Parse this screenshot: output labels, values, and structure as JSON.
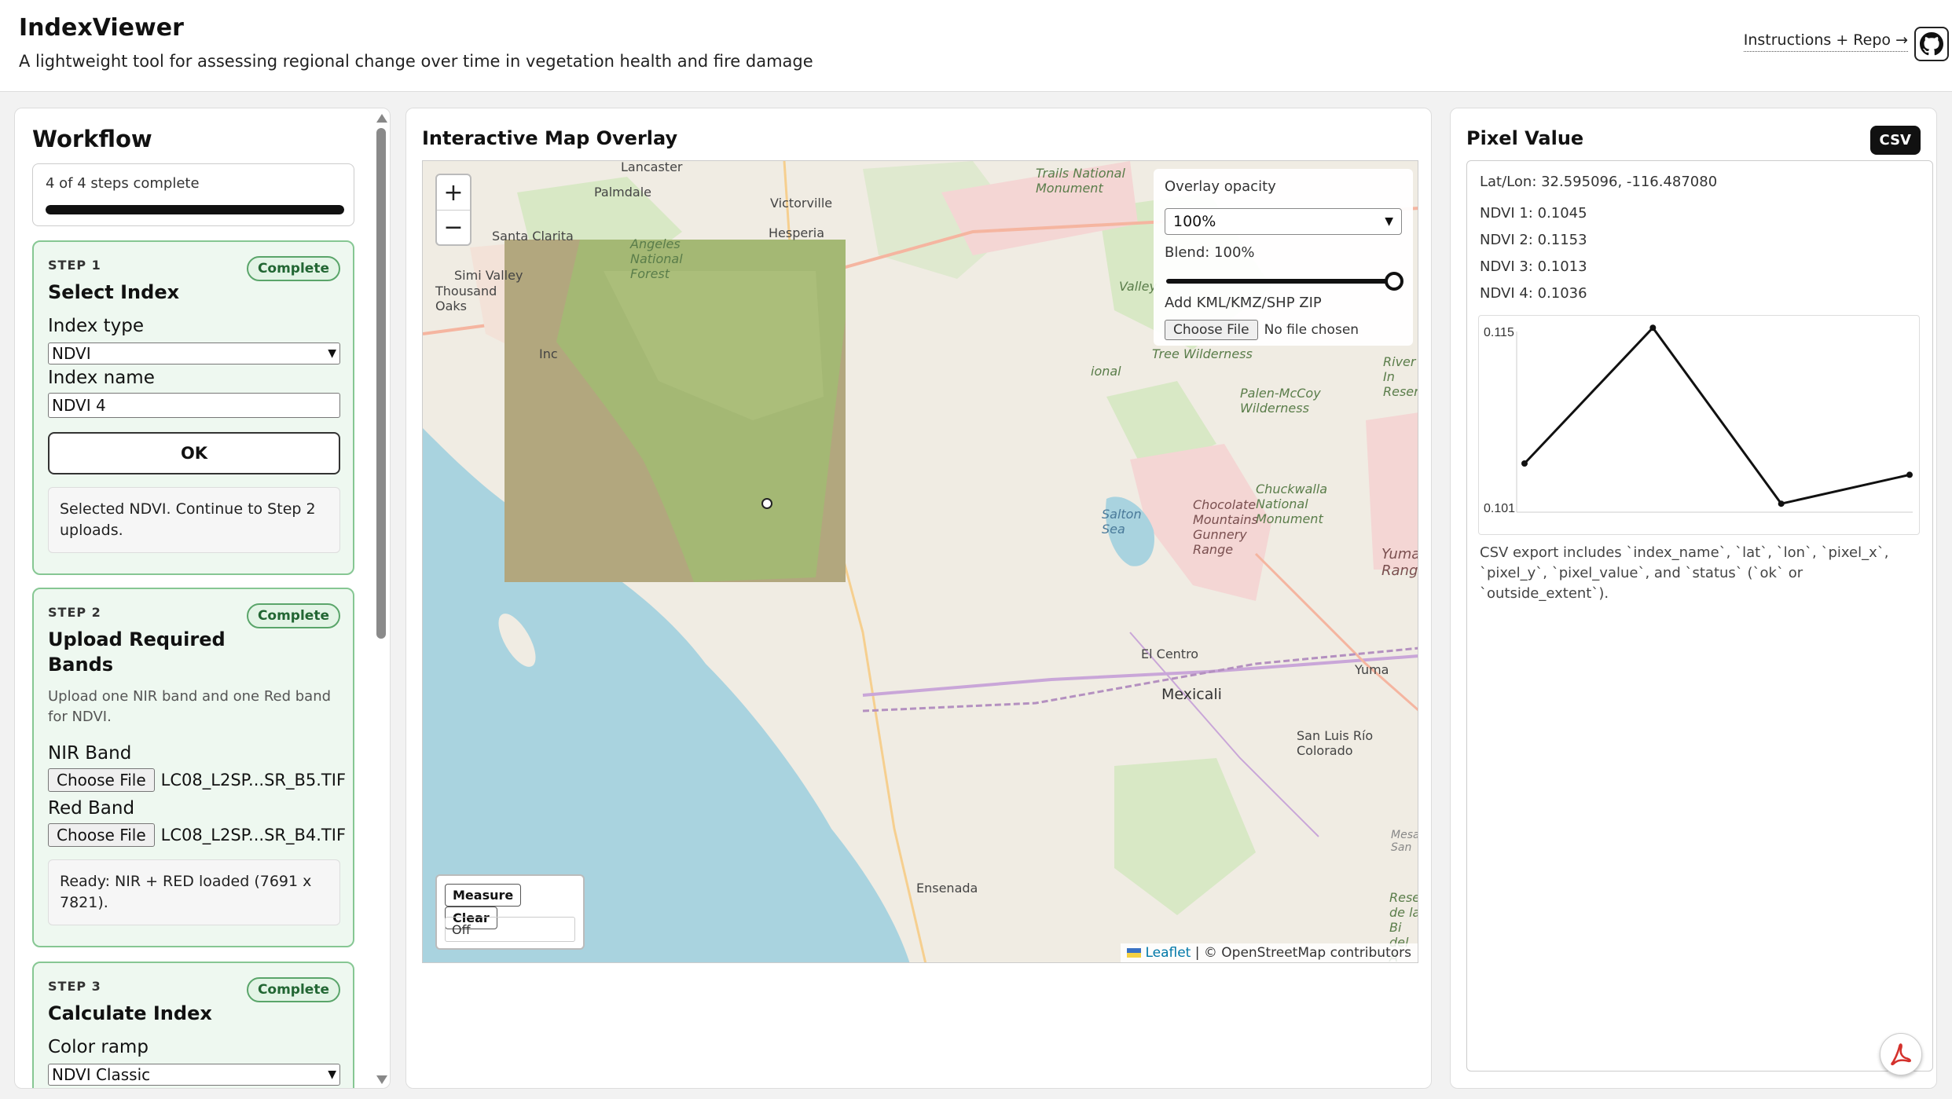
{
  "header": {
    "title": "IndexViewer",
    "subtitle": "A lightweight tool for assessing regional change over time in vegetation health and fire damage",
    "repo_link": "Instructions + Repo →",
    "github_icon": "github-icon"
  },
  "workflow": {
    "title": "Workflow",
    "progress_text": "4 of 4 steps complete",
    "progress_fraction": 1.0,
    "steps": [
      {
        "label": "STEP 1",
        "badge": "Complete",
        "title": "Select Index",
        "index_type_label": "Index type",
        "index_type_value": "NDVI",
        "index_name_label": "Index name",
        "index_name_value": "NDVI 4",
        "ok_label": "OK",
        "note": "Selected NDVI. Continue to Step 2 uploads."
      },
      {
        "label": "STEP 2",
        "badge": "Complete",
        "title": "Upload Required Bands",
        "description": "Upload one NIR band and one Red band for NDVI.",
        "nir_label": "NIR Band",
        "nir_button": "Choose File",
        "nir_file": "LC08_L2SP...SR_B5.TIF",
        "red_label": "Red Band",
        "red_button": "Choose File",
        "red_file": "LC08_L2SP...SR_B4.TIF",
        "note": "Ready: NIR + RED loaded (7691 x 7821)."
      },
      {
        "label": "STEP 3",
        "badge": "Complete",
        "title": "Calculate Index",
        "color_ramp_label": "Color ramp",
        "color_ramp_value": "NDVI Classic"
      }
    ]
  },
  "map": {
    "title": "Interactive Map Overlay",
    "zoom_in": "+",
    "zoom_out": "−",
    "overlay": {
      "opacity_label": "Overlay opacity",
      "opacity_value": "100%",
      "blend_label": "Blend: 100%",
      "blend_fraction": 1.0,
      "kml_label": "Add KML/KMZ/SHP ZIP",
      "file_button": "Choose File",
      "file_status": "No file chosen"
    },
    "measure_button": "Measure",
    "clear_button": "Clear",
    "measure_status": "Off",
    "attribution_leaflet": "Leaflet",
    "attribution_rest": "| © OpenStreetMap contributors",
    "place_labels": [
      "Lancaster",
      "Palmdale",
      "Victorville",
      "Hesperia",
      "Santa Clarita",
      "Angeles National Forest",
      "Simi Valley",
      "Thousand Oaks",
      "Trails National Monument",
      "Tree Wilderness",
      "Palen-McCoy Wilderness",
      "River In Reserv",
      "Chuckwalla National Monument",
      "Chocolate Mountains Gunnery Range",
      "Salton Sea",
      "Yuma Rang",
      "El Centro",
      "Yuma",
      "Mexicali",
      "San Luis Río Colorado",
      "Ensenada",
      "Mesa San",
      "Rese de la Bi del A",
      "Valley",
      "ional",
      "Inc"
    ]
  },
  "pixel": {
    "title": "Pixel Value",
    "csv_label": "CSV",
    "latlon": "Lat/Lon: 32.595096, -116.487080",
    "values": [
      "NDVI 1: 0.1045",
      "NDVI 2: 0.1153",
      "NDVI 3: 0.1013",
      "NDVI 4: 0.1036"
    ],
    "csv_note": "CSV export includes `index_name`, `lat`, `lon`, `pixel_x`, `pixel_y`, `pixel_value`, and `status` (`ok` or `outside_extent`).",
    "pdf_icon": "pdf-icon"
  },
  "chart_data": {
    "type": "line",
    "categories": [
      "NDVI 1",
      "NDVI 2",
      "NDVI 3",
      "NDVI 4"
    ],
    "values": [
      0.1045,
      0.1153,
      0.1013,
      0.1036
    ],
    "ylim": [
      0.101,
      0.115
    ],
    "ytick_labels": [
      "0.115",
      "0.101"
    ],
    "color": "#111111"
  }
}
